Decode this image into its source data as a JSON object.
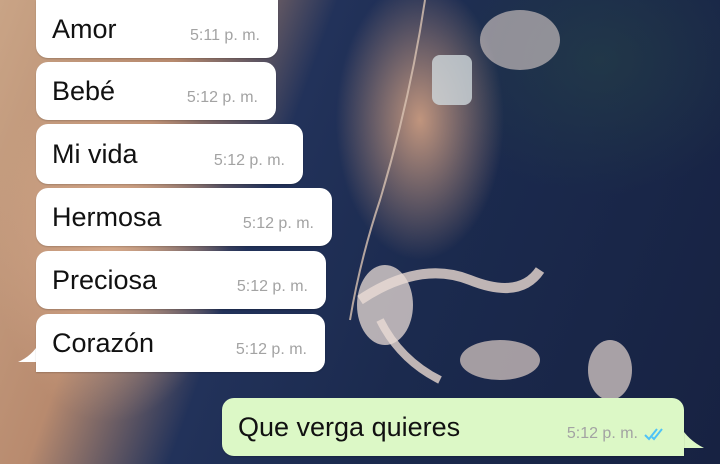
{
  "chat": {
    "incoming": [
      {
        "text": "Amor",
        "time": "5:11 p. m."
      },
      {
        "text": "Bebé",
        "time": "5:12 p. m."
      },
      {
        "text": "Mi vida",
        "time": "5:12 p. m."
      },
      {
        "text": "Hermosa",
        "time": "5:12 p. m."
      },
      {
        "text": "Preciosa",
        "time": "5:12 p. m."
      },
      {
        "text": "Corazón",
        "time": "5:12 p. m."
      }
    ],
    "outgoing": [
      {
        "text": "Que verga quieres",
        "time": "5:12 p. m.",
        "status_icon": "double-check-icon",
        "status_color": "#4fc3f7"
      }
    ]
  },
  "colors": {
    "incoming_bubble": "#ffffff",
    "outgoing_bubble": "#dcf8c6",
    "timestamp": "#a3a3a3"
  }
}
